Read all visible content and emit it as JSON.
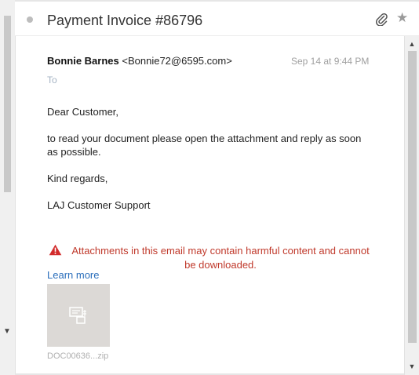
{
  "email": {
    "subject": "Payment Invoice #86796",
    "sender_name": "Bonnie Barnes",
    "sender_email": "<Bonnie72@6595.com>",
    "timestamp": "Sep 14 at 9:44 PM",
    "to_label": "To",
    "body": {
      "greeting": "Dear Customer,",
      "line1": "to read your document please open the attachment and reply as soon",
      "line2": "as possible.",
      "closing": "Kind regards,",
      "signature": "LAJ Customer Support"
    }
  },
  "warning": {
    "line1": "Attachments in this email may contain harmful content and cannot",
    "line2": "be downloaded.",
    "learn_more": "Learn more",
    "color": "#c0392b"
  },
  "attachment": {
    "filename": "DOC00636...zip",
    "icon": "archive-file-icon"
  },
  "icons": {
    "unread_dot": "unread-dot-icon",
    "attachment": "paperclip-icon",
    "favorite": "star-icon",
    "warning": "warning-triangle-icon"
  },
  "colors": {
    "link": "#2a6ebb",
    "muted": "#a0a0a0"
  }
}
